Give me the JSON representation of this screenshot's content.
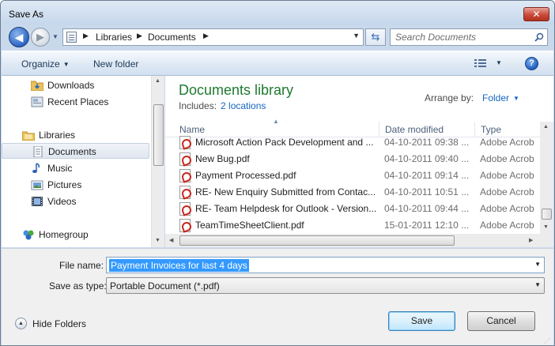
{
  "window": {
    "title": "Save As",
    "close_glyph": "✕"
  },
  "nav": {
    "back_icon": "back-arrow-icon",
    "forward_icon": "forward-arrow-icon"
  },
  "address": {
    "crumbs": [
      "Libraries",
      "Documents"
    ],
    "separator": "▶"
  },
  "search": {
    "placeholder": "Search Documents"
  },
  "toolbar": {
    "organize": "Organize",
    "new_folder": "New folder",
    "help": "?"
  },
  "navpane": {
    "items": [
      {
        "label": "Downloads",
        "icon": "downloads-folder-icon"
      },
      {
        "label": "Recent Places",
        "icon": "recent-places-icon"
      },
      {
        "label": "Libraries",
        "icon": "libraries-icon"
      },
      {
        "label": "Documents",
        "icon": "documents-icon",
        "selected": true
      },
      {
        "label": "Music",
        "icon": "music-icon"
      },
      {
        "label": "Pictures",
        "icon": "pictures-icon"
      },
      {
        "label": "Videos",
        "icon": "videos-icon"
      },
      {
        "label": "Homegroup",
        "icon": "homegroup-icon"
      }
    ]
  },
  "library": {
    "title": "Documents library",
    "includes_label": "Includes:",
    "includes_link": "2 locations",
    "arrange_label": "Arrange by:",
    "arrange_value": "Folder"
  },
  "columns": {
    "name": "Name",
    "date": "Date modified",
    "type": "Type"
  },
  "files": [
    {
      "name": "Microsoft Action Pack Development and ...",
      "date": "04-10-2011 09:38 ...",
      "type": "Adobe Acrob"
    },
    {
      "name": "New Bug.pdf",
      "date": "04-10-2011 09:40 ...",
      "type": "Adobe Acrob"
    },
    {
      "name": "Payment Processed.pdf",
      "date": "04-10-2011 09:14 ...",
      "type": "Adobe Acrob"
    },
    {
      "name": "RE- New Enquiry Submitted from Contac...",
      "date": "04-10-2011 10:51 ...",
      "type": "Adobe Acrob"
    },
    {
      "name": "RE- Team Helpdesk for Outlook - Version...",
      "date": "04-10-2011 09:44 ...",
      "type": "Adobe Acrob"
    },
    {
      "name": "TeamTimeSheetClient.pdf",
      "date": "15-01-2011 12:10 ...",
      "type": "Adobe Acrob"
    }
  ],
  "form": {
    "file_name_label": "File name:",
    "file_name_value": "Payment Invoices for last 4 days",
    "save_type_label": "Save as type:",
    "save_type_value": "Portable Document (*.pdf)"
  },
  "footer": {
    "hide_folders": "Hide Folders",
    "save": "Save",
    "cancel": "Cancel"
  },
  "colors": {
    "library_title": "#1e7a2f",
    "link": "#1566c0",
    "selection": "#3399ff",
    "close": "#c94a3a"
  }
}
